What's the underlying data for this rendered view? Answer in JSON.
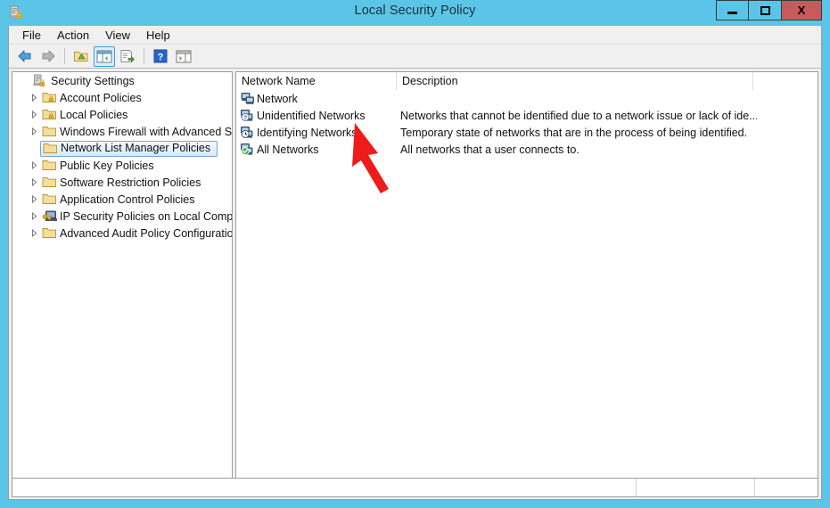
{
  "window": {
    "title": "Local Security Policy",
    "icon": "security-policy-icon",
    "controls": {
      "minimize": "minimize-button",
      "maximize": "maximize-button",
      "close": "X"
    },
    "accent_color": "#5bc5e7",
    "close_color": "#c75b5b"
  },
  "menu": {
    "items": [
      {
        "label": "File"
      },
      {
        "label": "Action"
      },
      {
        "label": "View"
      },
      {
        "label": "Help"
      }
    ]
  },
  "toolbar": {
    "buttons": [
      {
        "name": "back-arrow-icon",
        "title": "Back",
        "enabled": true
      },
      {
        "name": "forward-arrow-icon",
        "title": "Forward",
        "enabled": false
      },
      {
        "name": "up-folder-icon",
        "title": "Up One Level",
        "enabled": true
      },
      {
        "name": "show-hide-tree-icon",
        "title": "Show/Hide Console Tree",
        "enabled": true,
        "active": true
      },
      {
        "name": "export-list-icon",
        "title": "Export List",
        "enabled": true
      },
      {
        "name": "help-icon",
        "title": "Help",
        "enabled": true
      },
      {
        "name": "show-pane-icon",
        "title": "Show/Hide Action Pane",
        "enabled": true
      }
    ]
  },
  "tree": {
    "items": [
      {
        "label": "Security Settings",
        "indent": 0,
        "expander": "none",
        "icon": "security-settings-icon",
        "selected": false
      },
      {
        "label": "Account Policies",
        "indent": 1,
        "expander": "collapsed",
        "icon": "folder-lock-icon",
        "selected": false
      },
      {
        "label": "Local Policies",
        "indent": 1,
        "expander": "collapsed",
        "icon": "folder-lock-icon",
        "selected": false
      },
      {
        "label": "Windows Firewall with Advanced Secu",
        "indent": 1,
        "expander": "collapsed",
        "icon": "folder-icon",
        "selected": false
      },
      {
        "label": "Network List Manager Policies",
        "indent": 1,
        "expander": "none",
        "icon": "folder-icon",
        "selected": true
      },
      {
        "label": "Public Key Policies",
        "indent": 1,
        "expander": "collapsed",
        "icon": "folder-icon",
        "selected": false
      },
      {
        "label": "Software Restriction Policies",
        "indent": 1,
        "expander": "collapsed",
        "icon": "folder-icon",
        "selected": false
      },
      {
        "label": "Application Control Policies",
        "indent": 1,
        "expander": "collapsed",
        "icon": "folder-icon",
        "selected": false
      },
      {
        "label": "IP Security Policies on Local Compute",
        "indent": 1,
        "expander": "collapsed",
        "icon": "ip-security-icon",
        "selected": false
      },
      {
        "label": "Advanced Audit Policy Configuration",
        "indent": 1,
        "expander": "collapsed",
        "icon": "folder-icon",
        "selected": false
      }
    ],
    "hscrollbar": {
      "left_arrow": "‹",
      "right_arrow": "›",
      "grip": "███"
    }
  },
  "list": {
    "columns": [
      {
        "label": "Network Name"
      },
      {
        "label": "Description"
      }
    ],
    "rows": [
      {
        "name": "Network",
        "description": "",
        "icon": "network-icon"
      },
      {
        "name": "Unidentified Networks",
        "description": "Networks that cannot be identified due to a network issue or lack of ide...",
        "icon": "network-unidentified-icon"
      },
      {
        "name": "Identifying Networks",
        "description": "Temporary state of networks that are in the process of being identified.",
        "icon": "network-identifying-icon"
      },
      {
        "name": "All Networks",
        "description": "All networks that a user connects to.",
        "icon": "network-all-icon"
      }
    ]
  },
  "statusbar": {
    "cells": [
      "",
      "",
      ""
    ]
  },
  "annotation": {
    "type": "arrow",
    "color": "#ee1b1b",
    "points_to": "Unidentified Networks"
  }
}
